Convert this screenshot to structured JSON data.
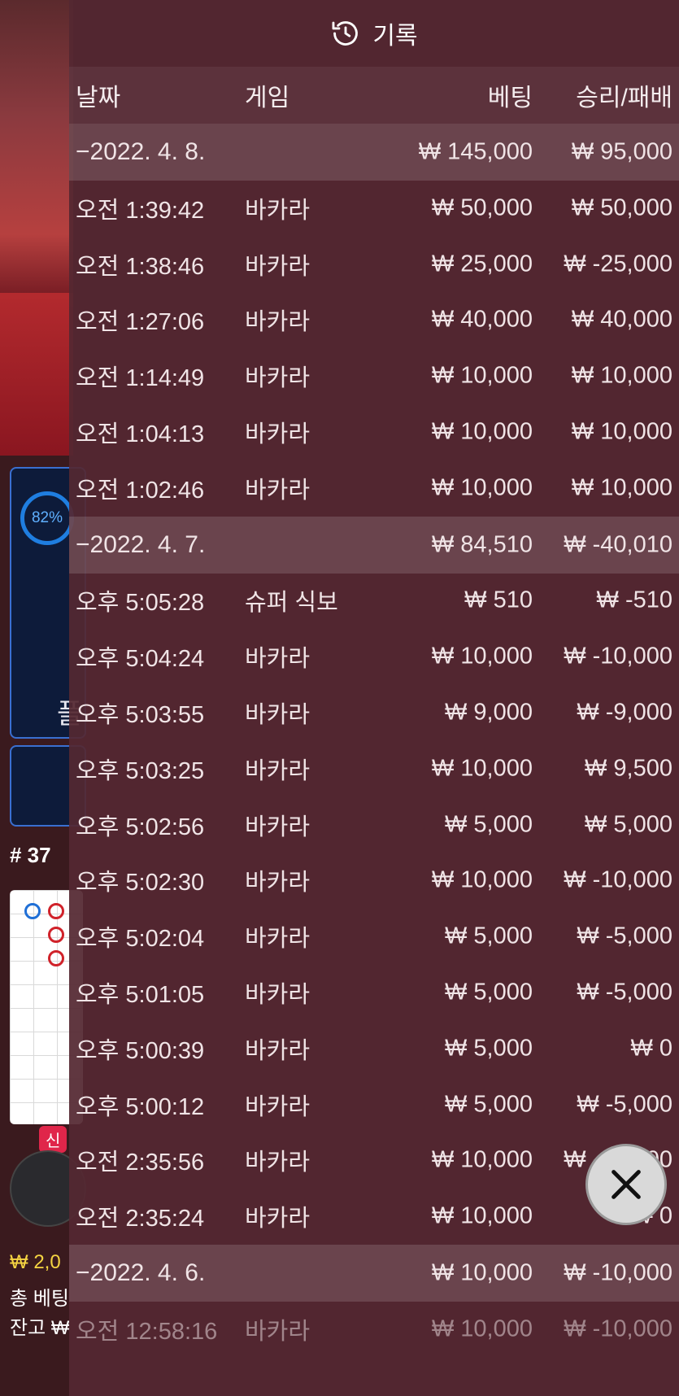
{
  "background": {
    "progress_percent_label": "82%",
    "player_label": "플",
    "round_number": "# 37",
    "new_badge": "신",
    "balance_line_1": "₩ 2,0",
    "balance_line_2": "총 베팅",
    "balance_line_3": "잔고 ₩"
  },
  "history": {
    "title": "기록",
    "columns": {
      "date": "날짜",
      "game": "게임",
      "bet": "베팅",
      "result": "승리/패배"
    },
    "groups": [
      {
        "date": "−2022. 4. 8.",
        "bet_total": "₩ 145,000",
        "result_total": "₩ 95,000",
        "rows": [
          {
            "time": "오전 1:39:42",
            "game": "바카라",
            "bet": "₩ 50,000",
            "result": "₩ 50,000"
          },
          {
            "time": "오전 1:38:46",
            "game": "바카라",
            "bet": "₩ 25,000",
            "result": "₩ -25,000"
          },
          {
            "time": "오전 1:27:06",
            "game": "바카라",
            "bet": "₩ 40,000",
            "result": "₩ 40,000"
          },
          {
            "time": "오전 1:14:49",
            "game": "바카라",
            "bet": "₩ 10,000",
            "result": "₩ 10,000"
          },
          {
            "time": "오전 1:04:13",
            "game": "바카라",
            "bet": "₩ 10,000",
            "result": "₩ 10,000"
          },
          {
            "time": "오전 1:02:46",
            "game": "바카라",
            "bet": "₩ 10,000",
            "result": "₩ 10,000"
          }
        ]
      },
      {
        "date": "−2022. 4. 7.",
        "bet_total": "₩ 84,510",
        "result_total": "₩ -40,010",
        "rows": [
          {
            "time": "오후 5:05:28",
            "game": "슈퍼 식보",
            "bet": "₩ 510",
            "result": "₩ -510"
          },
          {
            "time": "오후 5:04:24",
            "game": "바카라",
            "bet": "₩ 10,000",
            "result": "₩ -10,000"
          },
          {
            "time": "오후 5:03:55",
            "game": "바카라",
            "bet": "₩ 9,000",
            "result": "₩ -9,000"
          },
          {
            "time": "오후 5:03:25",
            "game": "바카라",
            "bet": "₩ 10,000",
            "result": "₩ 9,500"
          },
          {
            "time": "오후 5:02:56",
            "game": "바카라",
            "bet": "₩ 5,000",
            "result": "₩ 5,000"
          },
          {
            "time": "오후 5:02:30",
            "game": "바카라",
            "bet": "₩ 10,000",
            "result": "₩ -10,000"
          },
          {
            "time": "오후 5:02:04",
            "game": "바카라",
            "bet": "₩ 5,000",
            "result": "₩ -5,000"
          },
          {
            "time": "오후 5:01:05",
            "game": "바카라",
            "bet": "₩ 5,000",
            "result": "₩ -5,000"
          },
          {
            "time": "오후 5:00:39",
            "game": "바카라",
            "bet": "₩ 5,000",
            "result": "₩ 0"
          },
          {
            "time": "오후 5:00:12",
            "game": "바카라",
            "bet": "₩ 5,000",
            "result": "₩ -5,000"
          },
          {
            "time": "오전 2:35:56",
            "game": "바카라",
            "bet": "₩ 10,000",
            "result": "₩ -10,000"
          },
          {
            "time": "오전 2:35:24",
            "game": "바카라",
            "bet": "₩ 10,000",
            "result": "₩ 0"
          }
        ]
      },
      {
        "date": "−2022. 4. 6.",
        "bet_total": "₩ 10,000",
        "result_total": "₩ -10,000",
        "rows": [
          {
            "time": "오전 12:58:16",
            "game": "바카라",
            "bet": "₩ 10,000",
            "result": "₩ -10,000"
          }
        ]
      }
    ]
  },
  "icons": {
    "history": "history-clock-icon",
    "close": "close-icon"
  }
}
